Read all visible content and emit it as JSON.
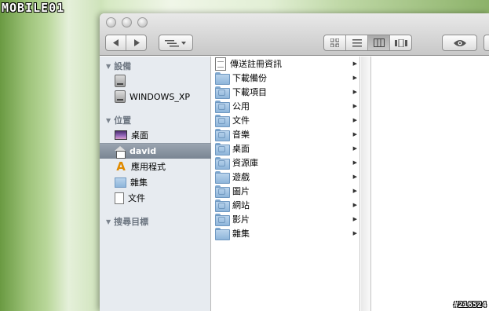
{
  "watermark": {
    "logo": "MOBILE01",
    "id": "#216524"
  },
  "toolbar": {
    "back_icon": "back-arrow-icon",
    "forward_icon": "forward-arrow-icon",
    "arrange_icon": "arrange-menu-icon",
    "views": [
      "icon-view-icon",
      "list-view-icon",
      "column-view-icon",
      "coverflow-view-icon"
    ],
    "active_view": "column",
    "quicklook_icon": "eye-icon"
  },
  "sidebar": {
    "devices_header": "設備",
    "devices": [
      {
        "label": "",
        "icon": "hard-drive-icon"
      },
      {
        "label": "WINDOWS_XP",
        "icon": "hard-drive-icon"
      }
    ],
    "places_header": "位置",
    "places": [
      {
        "label": "桌面",
        "icon": "desktop-icon"
      },
      {
        "label": "david",
        "icon": "home-icon",
        "selected": true
      },
      {
        "label": "應用程式",
        "icon": "applications-icon"
      },
      {
        "label": "雜集",
        "icon": "folder-icon"
      },
      {
        "label": "文件",
        "icon": "document-icon"
      }
    ],
    "search_header": "搜尋目標"
  },
  "column": {
    "items": [
      {
        "label": "傳送註冊資訊",
        "icon": "registration-document-icon"
      },
      {
        "label": "下載備份",
        "icon": "folder-icon"
      },
      {
        "label": "下載項目",
        "icon": "downloads-folder-icon"
      },
      {
        "label": "公用",
        "icon": "public-folder-icon"
      },
      {
        "label": "文件",
        "icon": "documents-folder-icon"
      },
      {
        "label": "音樂",
        "icon": "music-folder-icon"
      },
      {
        "label": "桌面",
        "icon": "desktop-folder-icon"
      },
      {
        "label": "資源庫",
        "icon": "library-folder-icon"
      },
      {
        "label": "遊戲",
        "icon": "folder-icon"
      },
      {
        "label": "圖片",
        "icon": "pictures-folder-icon"
      },
      {
        "label": "網站",
        "icon": "sites-folder-icon"
      },
      {
        "label": "影片",
        "icon": "movies-folder-icon"
      },
      {
        "label": "雜集",
        "icon": "folder-icon"
      }
    ]
  }
}
